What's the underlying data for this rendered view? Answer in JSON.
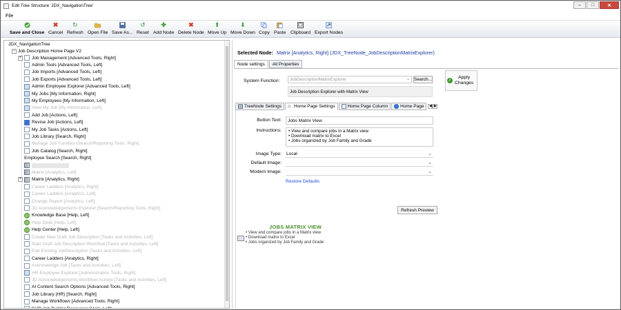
{
  "window": {
    "title": "Edit Tree Structure 'JDX_NavigationTree'"
  },
  "menu": {
    "file": "File"
  },
  "toolbar": {
    "save_close": "Save and Close",
    "cancel": "Cancel",
    "refresh": "Refresh",
    "open_file": "Open File",
    "save_as": "Save As...",
    "reset": "Reset",
    "add_node": "Add Node",
    "delete_node": "Delete Node",
    "move_up": "Move Up",
    "move_down": "Move Down",
    "copy": "Copy",
    "paste": "Paste",
    "clipboard": "Clipboard",
    "export_nodes": "Export Nodes"
  },
  "tree": {
    "root": "JDX_NavigationTree",
    "home": "Job Description Home Page V2",
    "items": [
      {
        "label": "Job Management [Advanced Tools, Right]",
        "dim": false,
        "icon": "doc",
        "expander": true
      },
      {
        "label": "Admin Tools [Advanced Tools, Left]",
        "dim": false,
        "icon": "doc"
      },
      {
        "label": "Job Imports [Advanced Tools, Left]",
        "dim": false,
        "icon": "doc"
      },
      {
        "label": "Job Exports [Advanced Tools, Left]",
        "dim": false,
        "icon": "doc"
      },
      {
        "label": "Admin Employee Explorer [Advanced Tools, Left]",
        "dim": false,
        "icon": "pers"
      },
      {
        "label": "My Jobs [My Information, Right]",
        "dim": false,
        "icon": "pers"
      },
      {
        "label": "My Employees [My Information, Left]",
        "dim": false,
        "icon": "pers"
      },
      {
        "label": "View My Job [My Information, Left]",
        "dim": true,
        "icon": "pers"
      },
      {
        "label": "Add Job [Actions, Left]",
        "dim": false,
        "icon": "doc"
      },
      {
        "label": "Revise Job [Actions, Left]",
        "dim": false,
        "icon": "pen"
      },
      {
        "label": "My Job Tasks [Actions, Left]",
        "dim": false,
        "icon": "doc"
      },
      {
        "label": "Job Library [Search, Right]",
        "dim": false,
        "icon": "doc"
      },
      {
        "label": "Manage Job Families [Search/Reporting Tools, Right]",
        "dim": true,
        "icon": "doc"
      },
      {
        "label": "Job Catalog [Search, Right]",
        "dim": false,
        "icon": "doc"
      },
      {
        "label": "Employee Search [Search, Right]",
        "dim": false,
        "icon": "none"
      },
      {
        "label": "",
        "dim": true,
        "icon": "grid",
        "bar": true
      },
      {
        "label": "Matrix [Analytics, Left]",
        "dim": true,
        "icon": "grid"
      },
      {
        "label": "Matrix [Analytics, Right]",
        "dim": false,
        "icon": "grid",
        "expander": true
      },
      {
        "label": "Career Ladders [Analytics, Right]",
        "dim": true,
        "icon": "doc"
      },
      {
        "label": "Career Ladders [Analytics, Left]",
        "dim": true,
        "icon": "doc"
      },
      {
        "label": "Change Report [Analytics, Left]",
        "dim": true,
        "icon": "doc"
      },
      {
        "label": "JD Acknowledgements Explorer [Search/Reporting Tools, Right]",
        "dim": true,
        "icon": "doc"
      },
      {
        "label": "Knowledge Base [Help, Left]",
        "dim": false,
        "icon": "grn"
      },
      {
        "label": "Help Desk [Help, Left]",
        "dim": true,
        "icon": "grn"
      },
      {
        "label": "Help Center [Help, Left]",
        "dim": false,
        "icon": "grn"
      },
      {
        "label": "Create New Draft Job Description [Tasks and Activities, Left]",
        "dim": true,
        "icon": "doc"
      },
      {
        "label": "Start Draft Job Description Workflow [Tasks and Activities, Left]",
        "dim": true,
        "icon": "doc"
      },
      {
        "label": "Edit Existing JobDescription [Tasks and Activities, Left]",
        "dim": true,
        "icon": "doc"
      },
      {
        "label": "Career Ladders [Analytics, Right]",
        "dim": false,
        "icon": "doc"
      },
      {
        "label": "Acknowledge Job [Tasks and Activities, Left]",
        "dim": true,
        "icon": "doc"
      },
      {
        "label": "HR Employee Explorer [Administration Tools, Right]",
        "dim": true,
        "icon": "pers"
      },
      {
        "label": "JD Acknowledgements Workflow Activity [Tasks and Activities, Left]",
        "dim": true,
        "icon": "doc"
      },
      {
        "label": "AI Content Search Options [Advanced Tools, Right]",
        "dim": false,
        "icon": "doc"
      },
      {
        "label": "Job Library (HR) [Search, Right]",
        "dim": false,
        "icon": "doc"
      },
      {
        "label": "Manage Workflows [Advanced Tools, Right]",
        "dim": false,
        "icon": "doc"
      },
      {
        "label": "SHR Job Builder Resources [Help, Left]",
        "dim": false,
        "icon": "doc"
      }
    ]
  },
  "selected": {
    "label": "Selected Node:",
    "value": "Matrix [Analytics, Right]  (JDX_TreeNode_JobDescriptionMatrixExplorer)"
  },
  "tabs_top": [
    "Node settings",
    "All Properties"
  ],
  "system_function": {
    "label": "System Function:",
    "value": "JobDescriptionMatrixExplorer",
    "search": "Search...",
    "description": "Job Description Explorer with Matrix View"
  },
  "apply": {
    "line1": "Apply",
    "line2": "Changes"
  },
  "tabs_mid": [
    "TreeNode Settings",
    "Home Page Settings",
    "Home Page Column",
    "Home Page"
  ],
  "form": {
    "button_text_label": "Button Text:",
    "button_text_value": "Jobs Matrix View",
    "instructions_label": "Instructions:",
    "instructions": [
      "• View and compare jobs in a Matrix view",
      "• Download matrix to Excel",
      "• Jobs organized by Job Family and Grade"
    ],
    "image_type_label": "Image Type:",
    "image_type_value": "Local",
    "default_image_label": "Default Image:",
    "modern_image_label": "Modern Image:",
    "restore": "Restore Defaults",
    "refresh_preview": "Refresh Preview"
  },
  "preview": {
    "title": "JOBS MATRIX VIEW",
    "items": [
      "• View and compare jobs in a Matrix view",
      "• Download matrix to Excel",
      "• Jobs organized by Job Family and Grade"
    ]
  },
  "colors": {
    "accent_green": "#4d8f2a",
    "link_blue": "#1a4ad6",
    "close_red": "#c94a3c"
  }
}
